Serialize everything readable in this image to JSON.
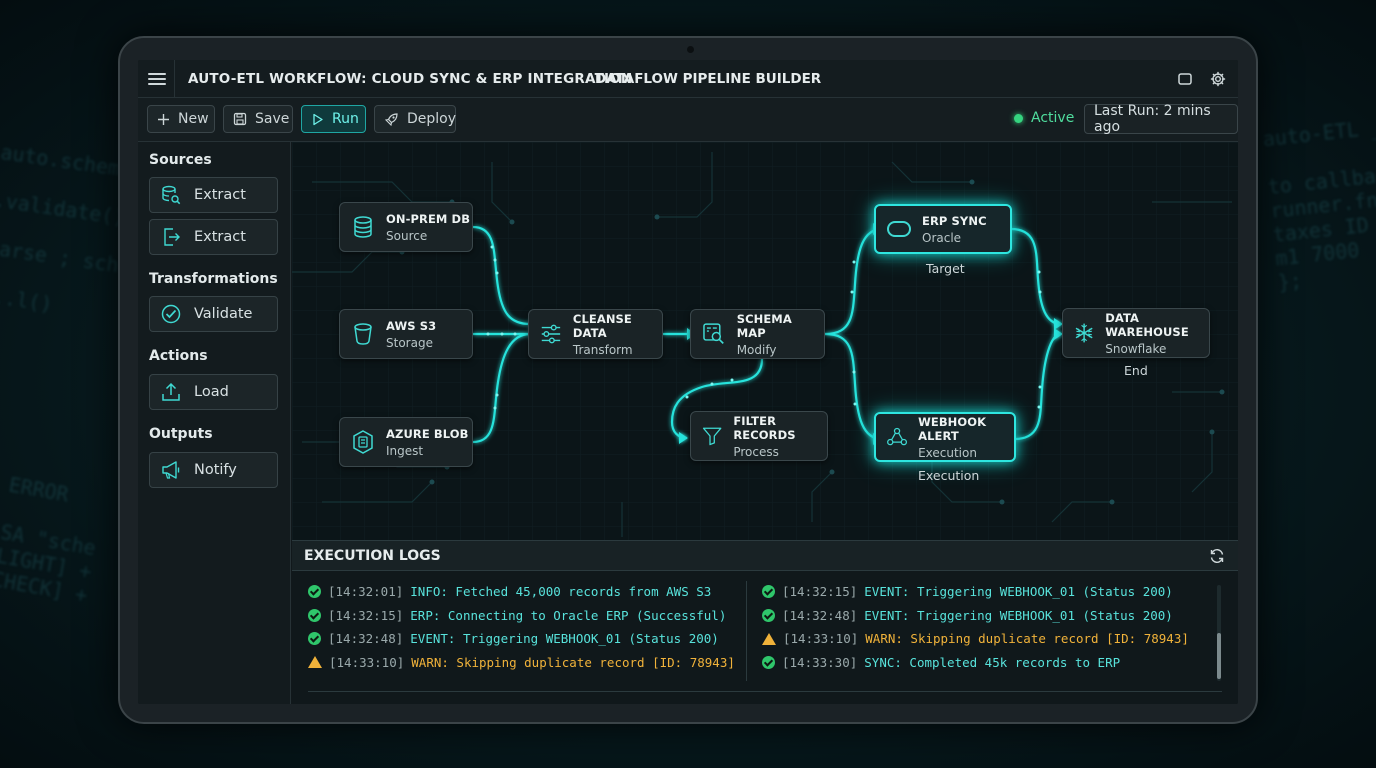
{
  "window": {
    "title": "AUTO-ETL WORKFLOW: CLOUD SYNC & ERP INTEGRATION",
    "center_title": "DATAFLOW PIPELINE BUILDER"
  },
  "toolbar": {
    "new_label": "New",
    "save_label": "Save",
    "run_label": "Run",
    "deploy_label": "Deploy",
    "status_label": "Active",
    "last_run": "Last Run: 2 mins ago"
  },
  "sidebar": {
    "sources_header": "Sources",
    "extract_db_label": "Extract",
    "extract_file_label": "Extract",
    "transformations_header": "Transformations",
    "validate_label": "Validate",
    "actions_header": "Actions",
    "load_label": "Load",
    "outputs_header": "Outputs",
    "notify_label": "Notify"
  },
  "pipeline": {
    "onprem": {
      "title": "ON-PREM DB",
      "sub": "Source"
    },
    "s3": {
      "title": "AWS S3",
      "sub": "Storage"
    },
    "azure": {
      "title": "AZURE BLOB",
      "sub": "Ingest"
    },
    "cleanse": {
      "title": "CLEANSE DATA",
      "sub": "Transform"
    },
    "schema": {
      "title": "SCHEMA MAP",
      "sub": "Modify"
    },
    "filter": {
      "title": "FILTER RECORDS",
      "sub": "Process"
    },
    "erp": {
      "title": "ERP SYNC",
      "sub": "Oracle",
      "label": "Target"
    },
    "webhook": {
      "title": "WEBHOOK ALERT",
      "sub": "Execution",
      "label": "Execution"
    },
    "warehouse": {
      "title": "DATA WAREHOUSE",
      "sub": "Snowflake",
      "label": "End"
    }
  },
  "logs": {
    "title": "EXECUTION LOGS",
    "left": [
      {
        "level": "ok",
        "time": "[14:32:01]",
        "msg": "INFO: Fetched 45,000 records from AWS S3"
      },
      {
        "level": "ok",
        "time": "[14:32:15]",
        "msg": "ERP: Connecting to Oracle ERP (Successful)"
      },
      {
        "level": "ok",
        "time": "[14:32:48]",
        "msg": "EVENT: Triggering WEBHOOK_01 (Status 200)"
      },
      {
        "level": "warn",
        "time": "[14:33:10]",
        "msg": "WARN: Skipping duplicate record [ID: 78943]"
      }
    ],
    "right": [
      {
        "level": "ok",
        "time": "[14:32:15]",
        "msg": "EVENT: Triggering WEBHOOK_01 (Status 200)"
      },
      {
        "level": "ok",
        "time": "[14:32:48]",
        "msg": "EVENT: Triggering WEBHOOK_01 (Status 200)"
      },
      {
        "level": "warn",
        "time": "[14:33:10]",
        "msg": "WARN: Skipping duplicate record [ID: 78943]"
      },
      {
        "level": "ok",
        "time": "[14:33:30]",
        "msg": "SYNC: Completed 45k records to ERP"
      }
    ]
  },
  "colors": {
    "accent": "#2ee6e0",
    "success": "#2fc66b",
    "warning": "#f0b23a",
    "active": "#35d47f"
  }
}
